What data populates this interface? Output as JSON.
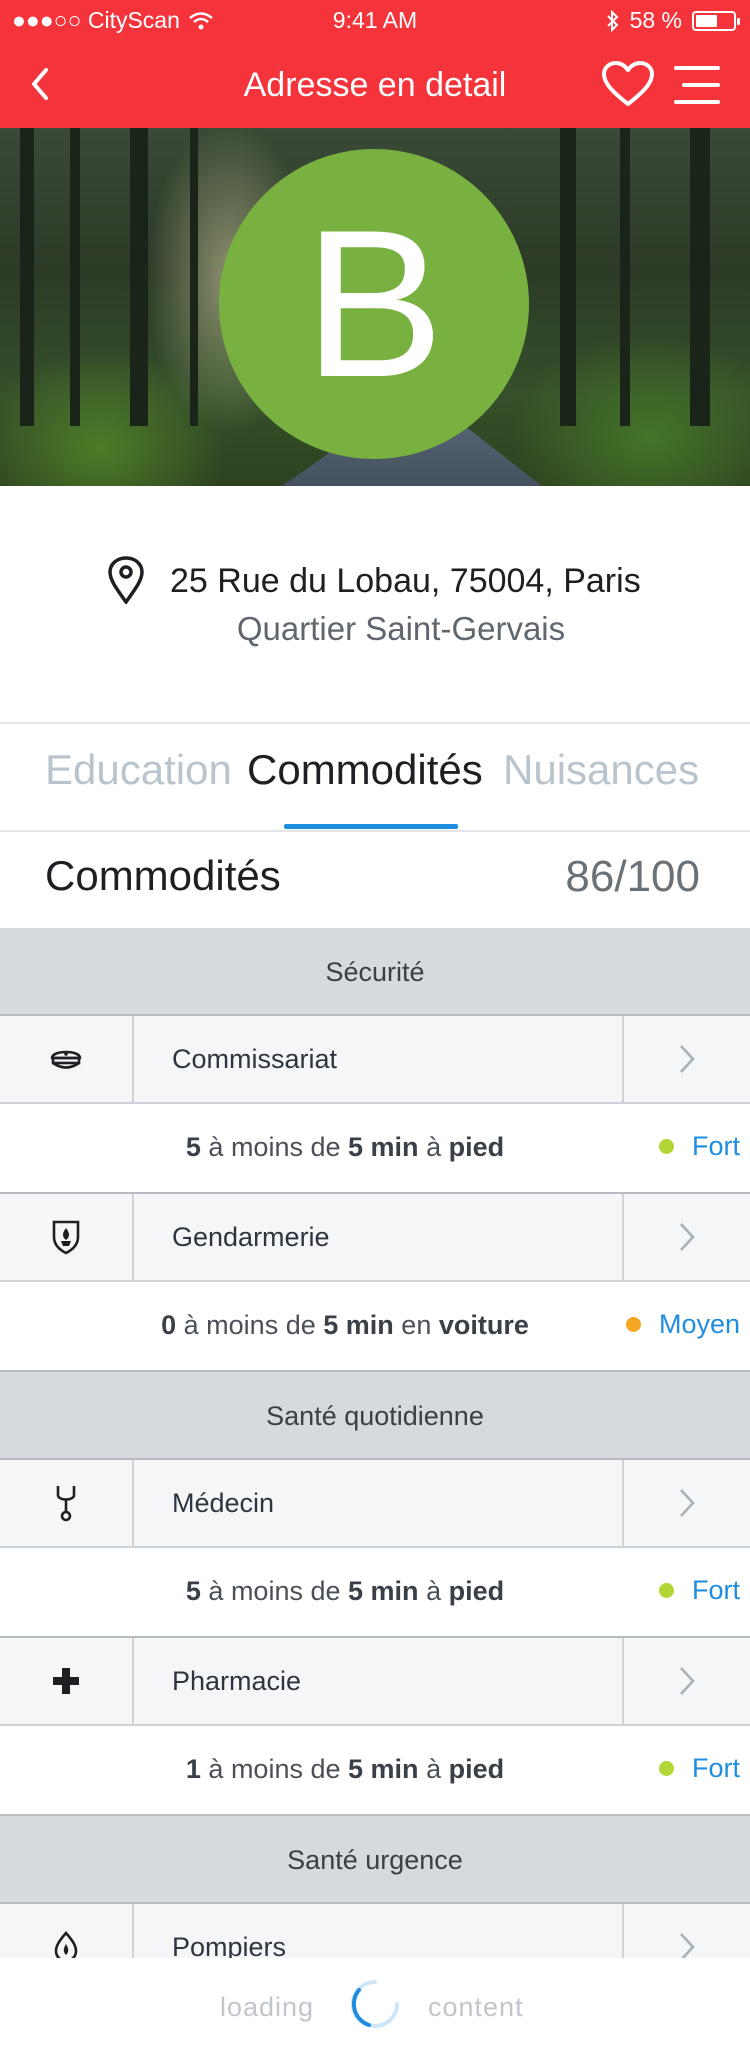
{
  "status_bar": {
    "carrier": "●●●○○ CityScan",
    "time": "9:41 AM",
    "battery_text": "58 %",
    "battery_level": 0.58
  },
  "nav": {
    "title": "Adresse en detail",
    "back_icon": "chevron-left-icon",
    "favorite_icon": "heart-icon",
    "menu_icon": "menu-icon"
  },
  "hero": {
    "grade": "B",
    "grade_color": "#78b13f"
  },
  "address": {
    "street": "25 Rue du Lobau, 75004, Paris",
    "district": "Quartier Saint-Gervais"
  },
  "tabs": [
    {
      "label": "Education",
      "active": false
    },
    {
      "label": "Commodités",
      "active": true
    },
    {
      "label": "Nuisances",
      "active": false
    }
  ],
  "section": {
    "title": "Commodités",
    "score": "86/100"
  },
  "colors": {
    "brand_red": "#f4333b",
    "accent_blue": "#1f8de0",
    "level_strong": "#b3d637",
    "level_medium": "#f5a623"
  },
  "categories": [
    {
      "title": "Sécurité",
      "items": [
        {
          "label": "Commissariat",
          "icon": "police-cap-icon",
          "count": "5",
          "mid": "à moins de",
          "time": "5 min",
          "conn": "à",
          "mode": "pied",
          "level": "Fort"
        },
        {
          "label": "Gendarmerie",
          "icon": "gendarmerie-badge-icon",
          "count": "0",
          "mid": "à moins de",
          "time": "5 min",
          "conn": "en",
          "mode": "voiture",
          "level": "Moyen"
        }
      ]
    },
    {
      "title": "Santé quotidienne",
      "items": [
        {
          "label": "Médecin",
          "icon": "stethoscope-icon",
          "count": "5",
          "mid": "à moins de",
          "time": "5 min",
          "conn": "à",
          "mode": "pied",
          "level": "Fort"
        },
        {
          "label": "Pharmacie",
          "icon": "pharmacy-cross-icon",
          "count": "1",
          "mid": "à moins de",
          "time": "5 min",
          "conn": "à",
          "mode": "pied",
          "level": "Fort"
        }
      ]
    },
    {
      "title": "Santé urgence",
      "items": [
        {
          "label": "Pompiers",
          "icon": "fire-icon"
        }
      ]
    }
  ],
  "loading": {
    "left": "loading",
    "right": "content"
  }
}
